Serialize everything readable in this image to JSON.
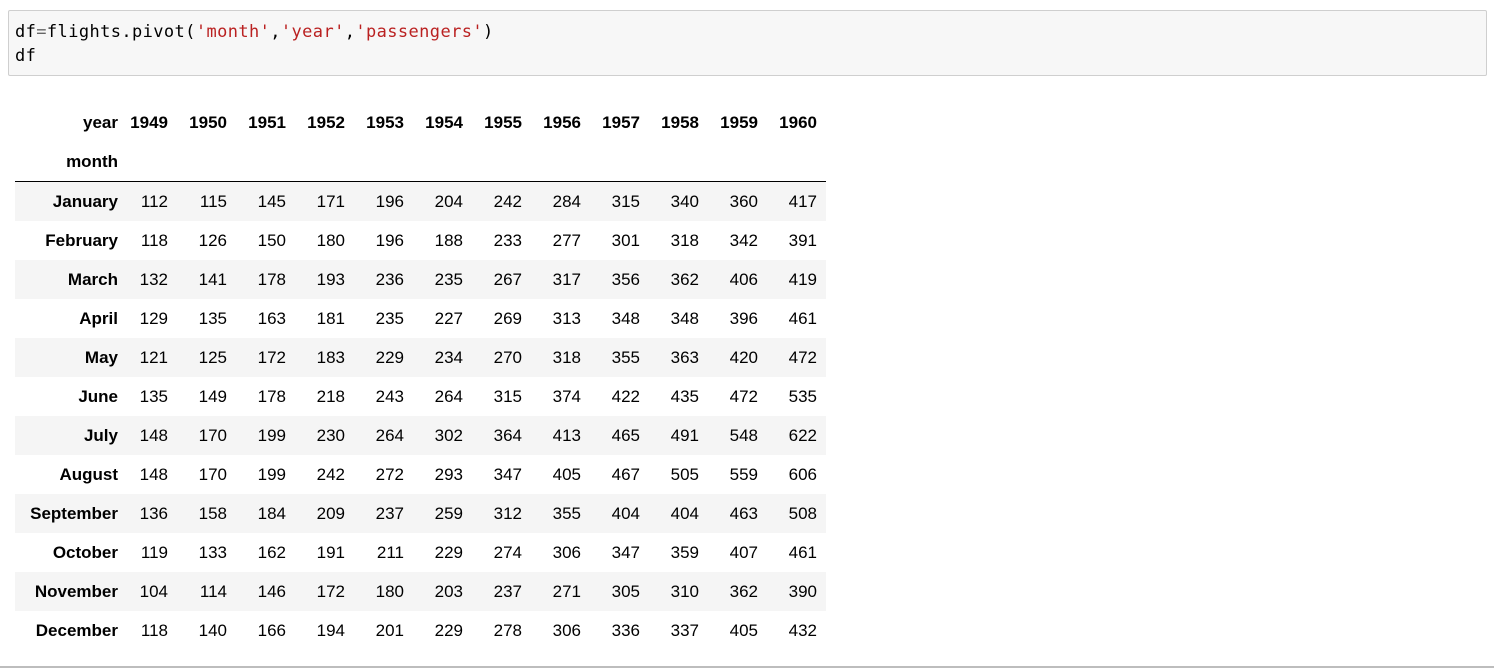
{
  "code": {
    "line1_pre": "df",
    "line1_eq": "=",
    "line1_call": "flights.pivot(",
    "line1_arg1": "'month'",
    "line1_sep1": ",",
    "line1_arg2": "'year'",
    "line1_sep2": ",",
    "line1_arg3": "'passengers'",
    "line1_close": ")",
    "line2": "df"
  },
  "table": {
    "columns_name": "year",
    "index_name": "month",
    "columns": [
      "1949",
      "1950",
      "1951",
      "1952",
      "1953",
      "1954",
      "1955",
      "1956",
      "1957",
      "1958",
      "1959",
      "1960"
    ],
    "rows": [
      {
        "month": "January",
        "values": [
          "112",
          "115",
          "145",
          "171",
          "196",
          "204",
          "242",
          "284",
          "315",
          "340",
          "360",
          "417"
        ]
      },
      {
        "month": "February",
        "values": [
          "118",
          "126",
          "150",
          "180",
          "196",
          "188",
          "233",
          "277",
          "301",
          "318",
          "342",
          "391"
        ]
      },
      {
        "month": "March",
        "values": [
          "132",
          "141",
          "178",
          "193",
          "236",
          "235",
          "267",
          "317",
          "356",
          "362",
          "406",
          "419"
        ]
      },
      {
        "month": "April",
        "values": [
          "129",
          "135",
          "163",
          "181",
          "235",
          "227",
          "269",
          "313",
          "348",
          "348",
          "396",
          "461"
        ]
      },
      {
        "month": "May",
        "values": [
          "121",
          "125",
          "172",
          "183",
          "229",
          "234",
          "270",
          "318",
          "355",
          "363",
          "420",
          "472"
        ]
      },
      {
        "month": "June",
        "values": [
          "135",
          "149",
          "178",
          "218",
          "243",
          "264",
          "315",
          "374",
          "422",
          "435",
          "472",
          "535"
        ]
      },
      {
        "month": "July",
        "values": [
          "148",
          "170",
          "199",
          "230",
          "264",
          "302",
          "364",
          "413",
          "465",
          "491",
          "548",
          "622"
        ]
      },
      {
        "month": "August",
        "values": [
          "148",
          "170",
          "199",
          "242",
          "272",
          "293",
          "347",
          "405",
          "467",
          "505",
          "559",
          "606"
        ]
      },
      {
        "month": "September",
        "values": [
          "136",
          "158",
          "184",
          "209",
          "237",
          "259",
          "312",
          "355",
          "404",
          "404",
          "463",
          "508"
        ]
      },
      {
        "month": "October",
        "values": [
          "119",
          "133",
          "162",
          "191",
          "211",
          "229",
          "274",
          "306",
          "347",
          "359",
          "407",
          "461"
        ]
      },
      {
        "month": "November",
        "values": [
          "104",
          "114",
          "146",
          "172",
          "180",
          "203",
          "237",
          "271",
          "305",
          "310",
          "362",
          "390"
        ]
      },
      {
        "month": "December",
        "values": [
          "118",
          "140",
          "166",
          "194",
          "201",
          "229",
          "278",
          "306",
          "336",
          "337",
          "405",
          "432"
        ]
      }
    ]
  }
}
